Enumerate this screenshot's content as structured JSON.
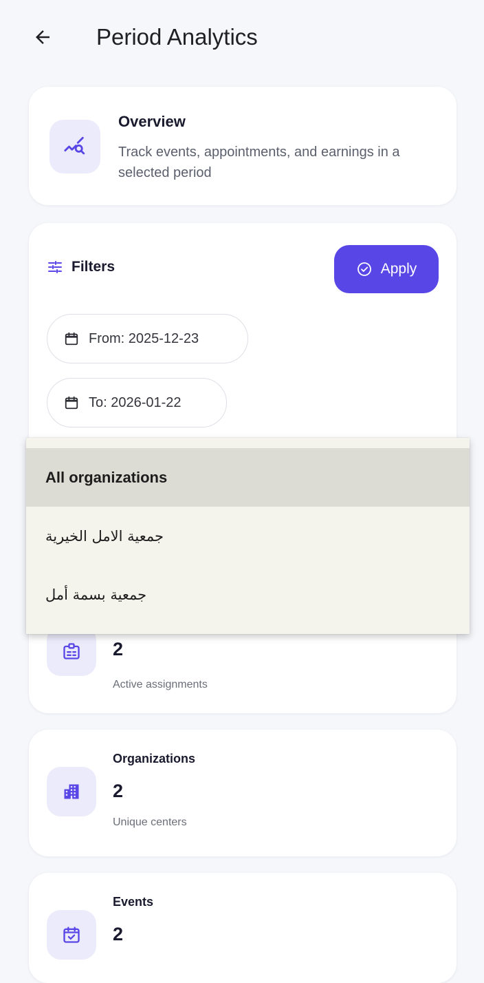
{
  "header": {
    "title": "Period Analytics",
    "back_icon": "arrow-left-icon"
  },
  "overview": {
    "title": "Overview",
    "description": "Track events, appointments, and earnings in a selected period",
    "icon": "analytics-search-icon"
  },
  "filters": {
    "label": "Filters",
    "icon": "tune-icon",
    "apply_label": "Apply",
    "from_label": "From: 2025-12-23",
    "to_label": "To: 2026-01-22"
  },
  "org_dropdown": {
    "options": [
      "All organizations",
      "جمعية الامل الخيرية",
      "جمعية بسمة أمل"
    ],
    "selected_index": 0
  },
  "stats": {
    "assignments": {
      "value": "2",
      "subtitle": "Active assignments",
      "icon": "badge-icon"
    },
    "organizations": {
      "title": "Organizations",
      "value": "2",
      "subtitle": "Unique centers",
      "icon": "building-icon"
    },
    "events": {
      "title": "Events",
      "value": "2",
      "icon": "calendar-check-icon"
    }
  },
  "colors": {
    "accent": "#5846e6",
    "icon_bg": "#ecebfb",
    "background": "#f6f7fb"
  }
}
